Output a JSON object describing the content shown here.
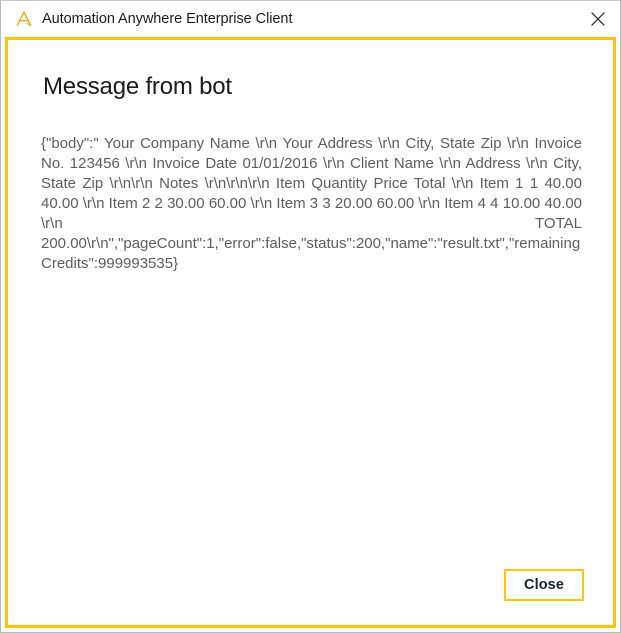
{
  "window": {
    "title": "Automation Anywhere Enterprise Client",
    "app_icon": "automation-anywhere-logo-icon",
    "close_icon": "close-icon",
    "border_color": "#ffc20e",
    "frame_color": "#b9b9b9"
  },
  "dialog": {
    "heading": "Message from bot",
    "message": "{\"body\":\"   Your Company Name \\r\\n      Your Address \\r\\n      City, State Zip \\r\\n      Invoice No. 123456 \\r\\n      Invoice Date 01/01/2016 \\r\\n      Client Name \\r\\n      Address \\r\\n      City, State Zip \\r\\n\\r\\n      Notes \\r\\n\\r\\n\\r\\n      Item      Quantity      Price      Total \\r\\n   Item 1   1   40.00   40.00 \\r\\n   Item 2   2   30.00   60.00 \\r\\n   Item 3   3   20.00   60.00 \\r\\n   Item 4   4   10.00   40.00 \\r\\n   TOTAL   200.00\\r\\n\",\"pageCount\":1,\"error\":false,\"status\":200,\"name\":\"result.txt\",\"remainingCredits\":999993535}",
    "invoice": {
      "company": "Your Company Name",
      "address": "Your Address",
      "city_state_zip": "City, State Zip",
      "invoice_no_label": "Invoice No.",
      "invoice_no": "123456",
      "invoice_date_label": "Invoice Date",
      "invoice_date": "01/01/2016",
      "client_name_label": "Client Name",
      "client_address_label": "Address",
      "client_city_state_zip": "City, State Zip",
      "notes_label": "Notes",
      "columns": [
        "Item",
        "Quantity",
        "Price",
        "Total"
      ],
      "rows": [
        {
          "item": "Item 1",
          "quantity": "1",
          "price": "40.00",
          "total": "40.00"
        },
        {
          "item": "Item 2",
          "quantity": "2",
          "price": "30.00",
          "total": "60.00"
        },
        {
          "item": "Item 3",
          "quantity": "3",
          "price": "20.00",
          "total": "60.00"
        },
        {
          "item": "Item 4",
          "quantity": "4",
          "price": "10.00",
          "total": "40.00"
        }
      ],
      "total_label": "TOTAL",
      "total_value": "200.00"
    },
    "response": {
      "pageCount": "1",
      "error": "false",
      "status": "200",
      "name": "result.txt",
      "remainingCredits": "999993535"
    }
  },
  "footer": {
    "close_label": "Close"
  }
}
